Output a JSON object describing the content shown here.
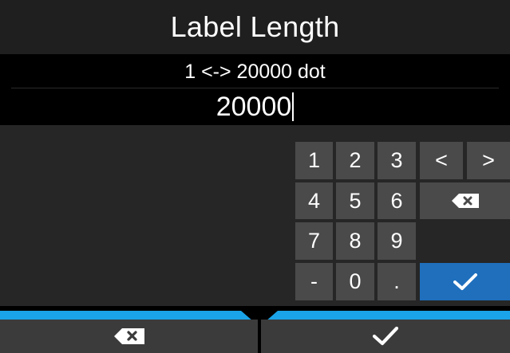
{
  "header": {
    "title": "Label Length"
  },
  "range": {
    "text": "1 <-> 20000 dot"
  },
  "input": {
    "value": "20000"
  },
  "keypad": {
    "keys": [
      "1",
      "2",
      "3",
      "4",
      "5",
      "6",
      "7",
      "8",
      "9",
      "-",
      "0",
      "."
    ],
    "left_label": "<",
    "right_label": ">"
  },
  "colors": {
    "accent_bar": "#1aa3e8",
    "confirm_key": "#1f6fbd",
    "key_bg": "#4a4a4a",
    "panel_bg": "#262626"
  },
  "icons": {
    "backspace": "backspace-icon",
    "confirm": "check-icon"
  }
}
